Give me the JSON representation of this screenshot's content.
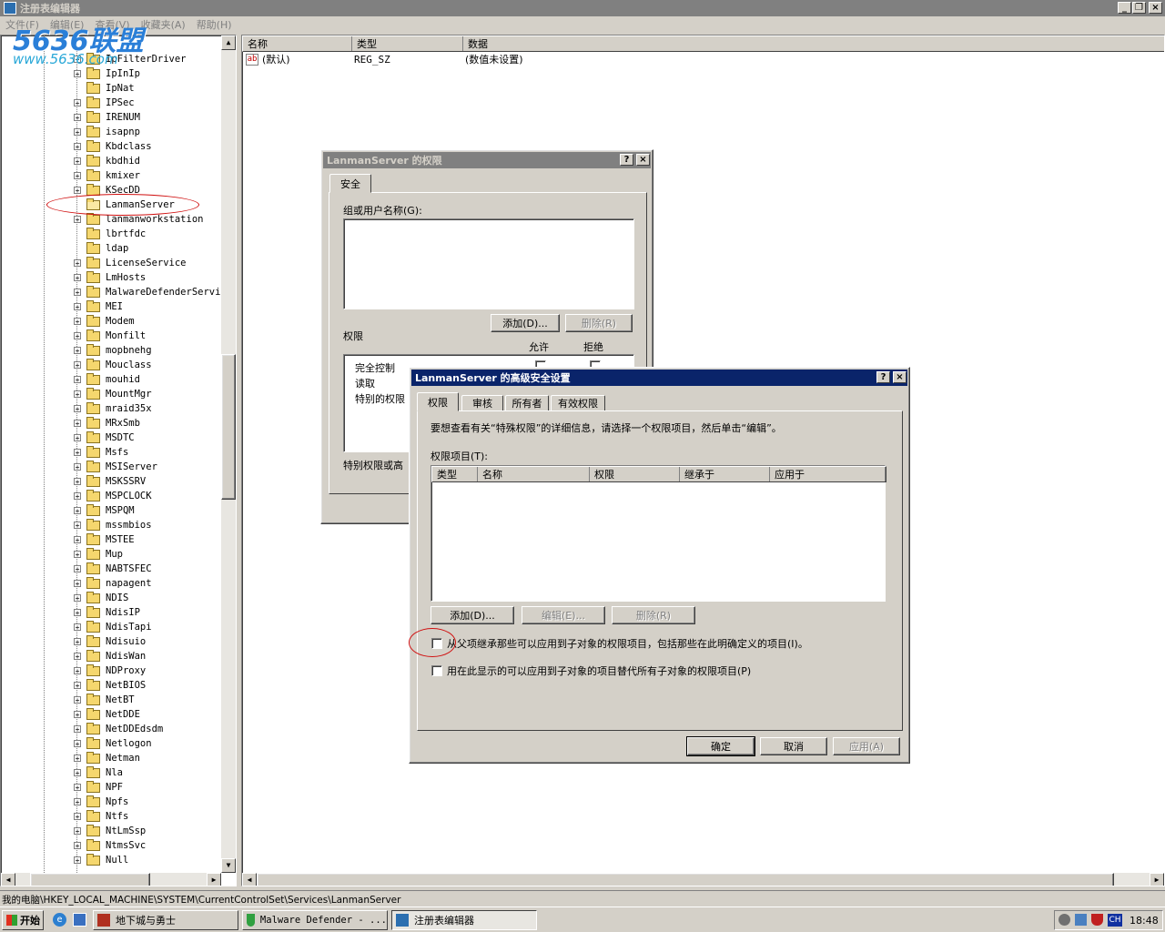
{
  "window": {
    "title": "注册表编辑器"
  },
  "watermark": {
    "logo": "5636联盟",
    "url": "www.5636.com"
  },
  "menu": [
    "文件(F)",
    "编辑(E)",
    "查看(V)",
    "收藏夹(A)",
    "帮助(H)"
  ],
  "tree": {
    "partial_top": "IpFilterDriver",
    "items": [
      {
        "label": "IpInIp",
        "expand": true
      },
      {
        "label": "IpNat",
        "expand": false
      },
      {
        "label": "IPSec",
        "expand": true
      },
      {
        "label": "IRENUM",
        "expand": true
      },
      {
        "label": "isapnp",
        "expand": true
      },
      {
        "label": "Kbdclass",
        "expand": true
      },
      {
        "label": "kbdhid",
        "expand": true
      },
      {
        "label": "kmixer",
        "expand": true
      },
      {
        "label": "KSecDD",
        "expand": true
      },
      {
        "label": "LanmanServer",
        "expand": false,
        "selected": true
      },
      {
        "label": "lanmanworkstation",
        "expand": true
      },
      {
        "label": "lbrtfdc",
        "expand": false
      },
      {
        "label": "ldap",
        "expand": false
      },
      {
        "label": "LicenseService",
        "expand": true
      },
      {
        "label": "LmHosts",
        "expand": true
      },
      {
        "label": "MalwareDefenderServic",
        "expand": true
      },
      {
        "label": "MEI",
        "expand": true
      },
      {
        "label": "Modem",
        "expand": true
      },
      {
        "label": "Monfilt",
        "expand": true
      },
      {
        "label": "mopbnehg",
        "expand": true
      },
      {
        "label": "Mouclass",
        "expand": true
      },
      {
        "label": "mouhid",
        "expand": true
      },
      {
        "label": "MountMgr",
        "expand": true
      },
      {
        "label": "mraid35x",
        "expand": true
      },
      {
        "label": "MRxSmb",
        "expand": true
      },
      {
        "label": "MSDTC",
        "expand": true
      },
      {
        "label": "Msfs",
        "expand": true
      },
      {
        "label": "MSIServer",
        "expand": true
      },
      {
        "label": "MSKSSRV",
        "expand": true
      },
      {
        "label": "MSPCLOCK",
        "expand": true
      },
      {
        "label": "MSPQM",
        "expand": true
      },
      {
        "label": "mssmbios",
        "expand": true
      },
      {
        "label": "MSTEE",
        "expand": true
      },
      {
        "label": "Mup",
        "expand": true
      },
      {
        "label": "NABTSFEC",
        "expand": true
      },
      {
        "label": "napagent",
        "expand": true
      },
      {
        "label": "NDIS",
        "expand": true
      },
      {
        "label": "NdisIP",
        "expand": true
      },
      {
        "label": "NdisTapi",
        "expand": true
      },
      {
        "label": "Ndisuio",
        "expand": true
      },
      {
        "label": "NdisWan",
        "expand": true
      },
      {
        "label": "NDProxy",
        "expand": true
      },
      {
        "label": "NetBIOS",
        "expand": true
      },
      {
        "label": "NetBT",
        "expand": true
      },
      {
        "label": "NetDDE",
        "expand": true
      },
      {
        "label": "NetDDEdsdm",
        "expand": true
      },
      {
        "label": "Netlogon",
        "expand": true
      },
      {
        "label": "Netman",
        "expand": true
      },
      {
        "label": "Nla",
        "expand": true
      },
      {
        "label": "NPF",
        "expand": true
      },
      {
        "label": "Npfs",
        "expand": true
      },
      {
        "label": "Ntfs",
        "expand": true
      },
      {
        "label": "NtLmSsp",
        "expand": true
      },
      {
        "label": "NtmsSvc",
        "expand": true
      },
      {
        "label": "Null",
        "expand": true
      }
    ]
  },
  "list": {
    "columns": [
      "名称",
      "类型",
      "数据"
    ],
    "rows": [
      {
        "name": "(默认)",
        "type": "REG_SZ",
        "data": "(数值未设置)",
        "icon": "ab"
      }
    ]
  },
  "statusbar": "我的电脑\\HKEY_LOCAL_MACHINE\\SYSTEM\\CurrentControlSet\\Services\\LanmanServer",
  "perm_dialog": {
    "title": "LanmanServer 的权限",
    "help": "?",
    "close": "×",
    "tab": "安全",
    "group_label": "组或用户名称(G):",
    "add": "添加(D)...",
    "remove": "删除(R)",
    "perm_label": "权限",
    "allow": "允许",
    "deny": "拒绝",
    "perms": [
      "完全控制",
      "读取",
      "特别的权限"
    ],
    "special_note": "特别权限或高"
  },
  "adv_dialog": {
    "title": "LanmanServer 的高级安全设置",
    "help": "?",
    "close": "×",
    "tabs": [
      "权限",
      "审核",
      "所有者",
      "有效权限"
    ],
    "info": "要想查看有关“特殊权限”的详细信息，请选择一个权限项目，然后单击“编辑”。",
    "entries_label": "权限项目(T):",
    "columns": [
      "类型",
      "名称",
      "权限",
      "继承于",
      "应用于"
    ],
    "add": "添加(D)...",
    "edit": "编辑(E)...",
    "remove": "删除(R)",
    "inherit_check": "从父项继承那些可以应用到子对象的权限项目，包括那些在此明确定义的项目(I)。",
    "replace_check": "用在此显示的可以应用到子对象的项目替代所有子对象的权限项目(P)",
    "ok": "确定",
    "cancel": "取消",
    "apply": "应用(A)"
  },
  "taskbar": {
    "start": "开始",
    "tasks": [
      "地下城与勇士",
      "Malware Defender - ...",
      "注册表编辑器"
    ],
    "ime": "CH",
    "clock": "18:48"
  },
  "colors": {
    "titlebar_active": "#0a246a",
    "face": "#d4d0c8",
    "annotation": "#d01010"
  }
}
